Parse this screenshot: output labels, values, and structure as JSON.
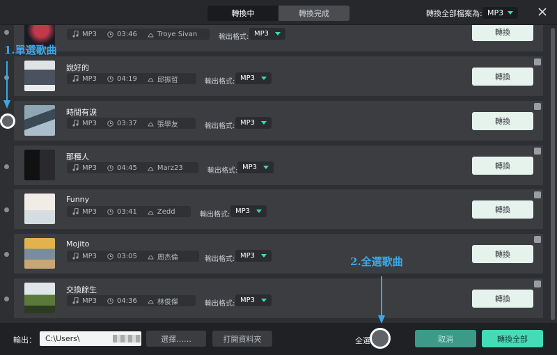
{
  "header": {
    "tabs": [
      {
        "label": "轉換中",
        "active": true
      },
      {
        "label": "轉換完成",
        "active": false
      }
    ],
    "format_label": "轉換全部檔案為:",
    "format_value": "MP3"
  },
  "songs": [
    {
      "title": "",
      "format": "MP3",
      "duration": "03:46",
      "artist": "Troye Sivan",
      "output_label": "輸出格式:",
      "output_format": "MP3",
      "convert_label": "轉換"
    },
    {
      "title": "說好的",
      "format": "MP3",
      "duration": "04:19",
      "artist": "邱振哲",
      "output_label": "輸出格式:",
      "output_format": "MP3",
      "convert_label": "轉換"
    },
    {
      "title": "時間有淚",
      "format": "MP3",
      "duration": "03:37",
      "artist": "張學友",
      "output_label": "輸出格式:",
      "output_format": "MP3",
      "convert_label": "轉換"
    },
    {
      "title": "那種人",
      "format": "MP3",
      "duration": "04:45",
      "artist": "Marz23",
      "output_label": "輸出格式:",
      "output_format": "MP3",
      "convert_label": "轉換"
    },
    {
      "title": "Funny",
      "format": "MP3",
      "duration": "03:41",
      "artist": "Zedd",
      "output_label": "輸出格式:",
      "output_format": "MP3",
      "convert_label": "轉換"
    },
    {
      "title": "Mojito",
      "format": "MP3",
      "duration": "03:05",
      "artist": "周杰倫",
      "output_label": "輸出格式:",
      "output_format": "MP3",
      "convert_label": "轉換"
    },
    {
      "title": "交換餘生",
      "format": "MP3",
      "duration": "04:36",
      "artist": "林俊傑",
      "output_label": "輸出格式:",
      "output_format": "MP3",
      "convert_label": "轉換"
    }
  ],
  "footer": {
    "output_label": "輸出：",
    "output_path": "C:\\Users\\",
    "choose_label": "選擇……",
    "open_folder_label": "打開資料夾",
    "select_all_label": "全選",
    "cancel_label": "取消",
    "convert_all_label": "轉換全部"
  },
  "annotations": {
    "step1": "1.單選歌曲",
    "step2": "2.全選歌曲"
  },
  "colors": {
    "accent": "#45dbb7",
    "annotation": "#3aa8e6"
  }
}
